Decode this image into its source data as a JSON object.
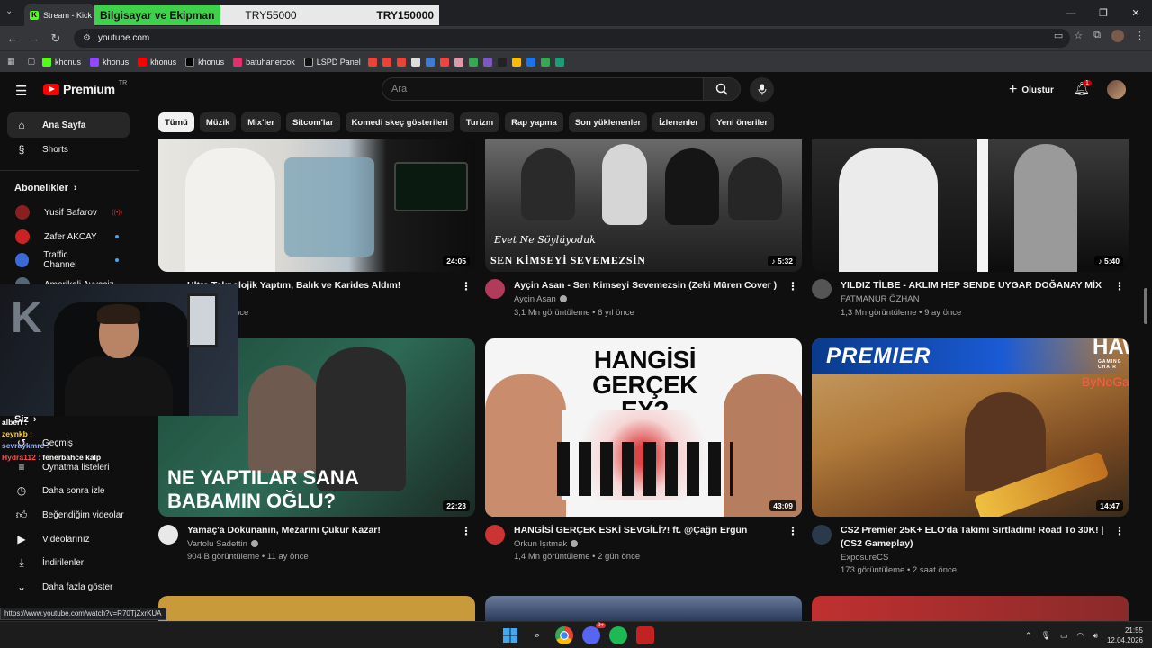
{
  "browser": {
    "tab_title": "Stream - Kick D",
    "url": "youtube.com",
    "status_url": "https://www.youtube.com/watch?v=R70TjZxrKUA",
    "bookmarks": [
      "khonus",
      "khonus",
      "khonus",
      "khonus",
      "batuhanercok",
      "LSPD Panel"
    ]
  },
  "price_overlay": {
    "category": "Bilgisayar ve Ekipman",
    "value_a": "TRY55000",
    "value_b": "TRY150000"
  },
  "header": {
    "logo_text": "Premium",
    "logo_region": "TR",
    "search_placeholder": "Ara",
    "create_label": "Oluştur",
    "notification_count": "1"
  },
  "chips": [
    "Tümü",
    "Müzik",
    "Mix'ler",
    "Sitcom'lar",
    "Komedi skeç gösterileri",
    "Turizm",
    "Rap yapma",
    "Son yüklenenler",
    "İzlenenler",
    "Yeni öneriler"
  ],
  "sidebar": {
    "home": "Ana Sayfa",
    "shorts": "Shorts",
    "subscriptions_header": "Abonelikler",
    "subscriptions": [
      {
        "name": "Yusif Safarov",
        "color": "#8a1f1f"
      },
      {
        "name": "Zafer AKCAY",
        "color": "#cc2222"
      },
      {
        "name": "Traffic Channel",
        "color": "#3a6ad6"
      },
      {
        "name": "Amerikali Ayvaciz",
        "color": "#556677"
      }
    ],
    "you_header": "Siz",
    "items": [
      "Geçmiş",
      "Oynatma listeleri",
      "Daha sonra izle",
      "Beğendiğim videolar",
      "Videolarınız",
      "İndirilenler",
      "Daha fazla göster"
    ]
  },
  "chat": [
    {
      "user": "albert :",
      "color": "#ffffff",
      "text": ""
    },
    {
      "user": "zeynkb :",
      "color": "#ffd23f",
      "text": ""
    },
    {
      "user": "sevraykmrc :",
      "color": "#9ab3ff",
      "text": ""
    },
    {
      "user": "Hydra112 :",
      "color": "#ff4d4d",
      "text": "fenerbahce kalp"
    }
  ],
  "videos": [
    {
      "title": "Ultra Teknolojik Yaptım, Balık ve Karides Aldım!",
      "channel": "nur",
      "meta": "üle • 1 gün önce",
      "duration": "24:05"
    },
    {
      "title": "Ayçin Asan - Sen Kimseyi Sevemezsin (Zeki Müren Cover )",
      "channel": "Ayçin Asan",
      "meta": "3,1 Mn görüntüleme • 6 yıl önce",
      "duration": "♪ 5:32",
      "thumb_line1": "Evet Ne Söylüyoduk",
      "thumb_line2": "SEN KİMSEYİ SEVEMEZSİN"
    },
    {
      "title": "YILDIZ TİLBE - AKLIM HEP SENDE UYGAR DOĞANAY MİX",
      "channel": "FATMANUR ÖZHAN",
      "meta": "1,3 Mn görüntüleme • 9 ay önce",
      "duration": "♪ 5:40"
    },
    {
      "title": "Yamaç'a Dokunanın, Mezarını Çukur Kazar!",
      "channel": "Vartolu Sadettin",
      "meta": "904 B görüntüleme • 11 ay önce",
      "duration": "22:23",
      "thumb_text": "NE YAPTILAR SANA BABAMIN OĞLU?"
    },
    {
      "title": "HANGİSİ GERÇEK ESKİ SEVGİLİ?! ft. @Çağrı Ergün",
      "channel": "Orkun Işıtmak",
      "meta": "1,4 Mn görüntüleme • 2 gün önce",
      "duration": "43:09",
      "thumb_text": "HANGİSİ GERÇEK EX?"
    },
    {
      "title": "CS2 Premier 25K+ ELO'da Takımı Sırtladım! Road To 30K! | (CS2 Gameplay)",
      "channel": "ExposureCS",
      "meta": "173 görüntüleme • 2 saat önce",
      "duration": "14:47",
      "thumb_text": "PREMIER",
      "thumb_brand": "HAWK",
      "thumb_brand_sub": "GAMING CHAIR",
      "thumb_brand2": "ByNoGame"
    }
  ],
  "taskbar": {
    "time": "21:55",
    "date": "12.04.2026",
    "discord_badge": "9+"
  }
}
